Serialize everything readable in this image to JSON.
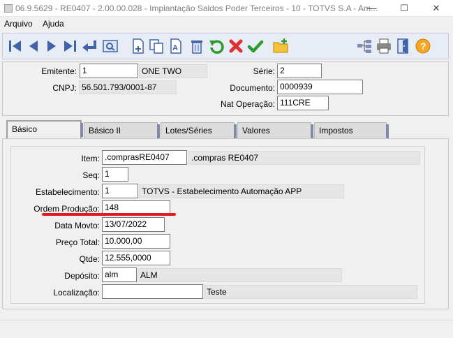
{
  "window": {
    "title": "06.9.5629 - RE0407 - 2.00.00.028 - Implantação Saldos Poder Terceiros - 10 - TOTVS S.A - Am...",
    "minimize": "—",
    "maximize": "☐",
    "close": "✕"
  },
  "menu": {
    "items": [
      "Arquivo",
      "Ajuda"
    ]
  },
  "toolbar": {
    "icons": [
      "first-record-icon",
      "previous-record-icon",
      "next-record-icon",
      "last-record-icon",
      "goto-icon",
      "search-icon",
      "new-record-icon",
      "copy-record-icon",
      "edit-record-icon",
      "delete-record-icon",
      "undo-icon",
      "cancel-icon",
      "confirm-icon",
      "new-folder-icon",
      "tree-icon",
      "print-icon",
      "exit-icon",
      "help-icon"
    ]
  },
  "header": {
    "emitente_label": "Emitente:",
    "emitente_value": "1",
    "emitente_name": "ONE TWO",
    "serie_label": "Série:",
    "serie_value": "2",
    "cnpj_label": "CNPJ:",
    "cnpj_value": "56.501.793/0001-87",
    "documento_label": "Documento:",
    "documento_value": "0000939",
    "natop_label": "Nat Operação:",
    "natop_value": "111CRE"
  },
  "tabs": [
    "Básico",
    "Básico II",
    "Lotes/Séries",
    "Valores",
    "Impostos"
  ],
  "form": {
    "item_label": "Item:",
    "item_value": ".comprasRE0407",
    "item_desc": ".compras RE0407",
    "seq_label": "Seq:",
    "seq_value": "1",
    "estab_label": "Estabelecimento:",
    "estab_value": "1",
    "estab_desc": "TOTVS - Estabelecimento Automação APP",
    "ordem_label": "Ordem Produção:",
    "ordem_value": "148",
    "data_label": "Data Movto:",
    "data_value": "13/07/2022",
    "preco_label": "Preço Total:",
    "preco_value": "10.000,00",
    "qtde_label": "Qtde:",
    "qtde_value": "12.555,0000",
    "deposito_label": "Depósito:",
    "deposito_value": "alm",
    "deposito_desc": "ALM",
    "local_label": "Localização:",
    "local_value": "",
    "local_desc": "Teste"
  },
  "colors": {
    "annotation_red": "#e01c1c",
    "toolbar_bg": "#e8ecf5",
    "nav_blue": "#3f63a8"
  }
}
